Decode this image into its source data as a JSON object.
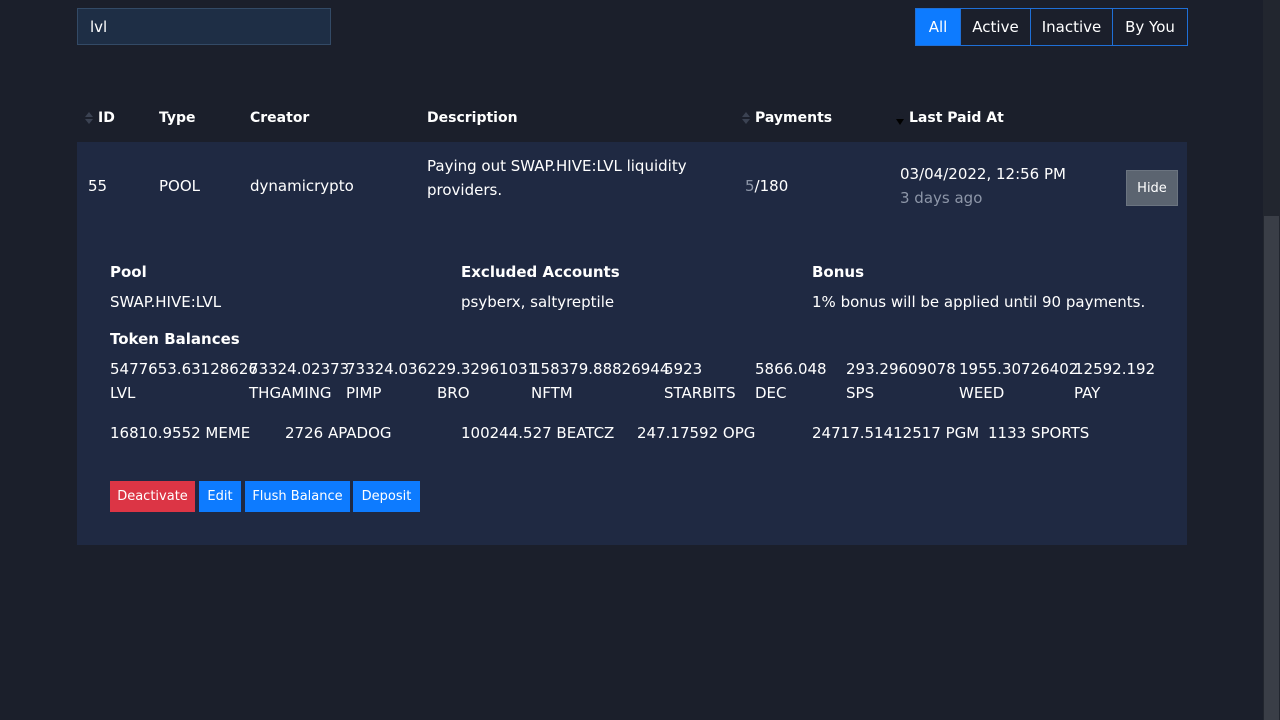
{
  "search": {
    "value": "lvl",
    "placeholder": ""
  },
  "filters": [
    {
      "label": "All",
      "active": true
    },
    {
      "label": "Active",
      "active": false
    },
    {
      "label": "Inactive",
      "active": false
    },
    {
      "label": "By You",
      "active": false
    }
  ],
  "columns": {
    "id": "ID",
    "type": "Type",
    "creator": "Creator",
    "description": "Description",
    "payments": "Payments",
    "last_paid_at": "Last Paid At"
  },
  "row": {
    "id": "55",
    "type": "POOL",
    "creator": "dynamicrypto",
    "description": "Paying out SWAP.HIVE:LVL liquidity providers.",
    "payments_done": "5",
    "payments_total": "/180",
    "last_paid_date": "03/04/2022, 12:56 PM",
    "last_paid_relative": "3 days ago",
    "hide_label": "Hide"
  },
  "details": {
    "pool_label": "Pool",
    "pool_value": "SWAP.HIVE:LVL",
    "excluded_label": "Excluded Accounts",
    "excluded_value": "psyberx, saltyreptile",
    "bonus_label": "Bonus",
    "bonus_value": "1% bonus will be applied until 90 payments.",
    "balances_label": "Token Balances",
    "balances_row1": [
      {
        "amount": "5477653.63128626",
        "token": "LVL"
      },
      {
        "amount": "73324.02373",
        "token": "THGAMING"
      },
      {
        "amount": "73324.0362",
        "token": "PIMP"
      },
      {
        "amount": "29.32961031",
        "token": "BRO"
      },
      {
        "amount": "158379.88826944",
        "token": "NFTM"
      },
      {
        "amount": "5923",
        "token": "STARBITS"
      },
      {
        "amount": "5866.048",
        "token": "DEC"
      },
      {
        "amount": "293.29609078",
        "token": "SPS"
      },
      {
        "amount": "1955.30726402",
        "token": "WEED"
      },
      {
        "amount": "12592.192",
        "token": "PAY"
      }
    ],
    "balances_row2": [
      "16810.9552 MEME",
      "2726 APADOG",
      "100244.527 BEATCZ",
      "247.17592 OPG",
      "24717.51412517 PGM",
      "1133 SPORTS"
    ]
  },
  "actions": {
    "deactivate": "Deactivate",
    "edit": "Edit",
    "flush": "Flush Balance",
    "deposit": "Deposit"
  },
  "colors": {
    "background": "#1b1f2b",
    "panel": "#1f2942",
    "primary": "#0d7bff",
    "danger": "#dc3545",
    "muted_text": "#8d96a8"
  }
}
